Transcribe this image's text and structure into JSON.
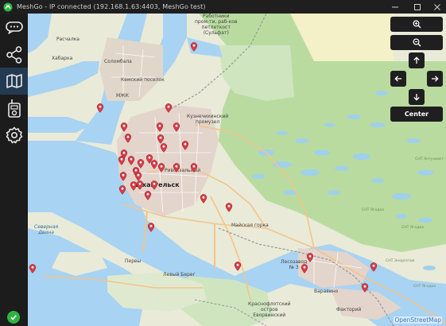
{
  "window": {
    "title": "MeshGo - IP connected (192.168.1.63:4403, MeshGo test)",
    "icon": "meshgo-logo"
  },
  "sidebar": {
    "items": [
      {
        "name": "chats",
        "icon": "chat-bubble-icon",
        "active": false
      },
      {
        "name": "nodes",
        "icon": "network-icon",
        "active": false
      },
      {
        "name": "map",
        "icon": "map-icon",
        "active": true
      },
      {
        "name": "device",
        "icon": "radio-device-icon",
        "active": false
      },
      {
        "name": "settings",
        "icon": "gear-icon",
        "active": false
      }
    ],
    "status_icon": "check-circle-icon",
    "status_color": "#2fb344",
    "active_color": "#243a52"
  },
  "map_controls": {
    "zoom_in": "zoom-in-icon",
    "zoom_out": "zoom-out-icon",
    "up": "arrow-up-icon",
    "left": "arrow-left-icon",
    "right": "arrow-right-icon",
    "down": "arrow-down-icon",
    "center_label": "Center"
  },
  "map": {
    "attribution": "OpenStreetMap",
    "labels": [
      {
        "text": "Работники\nпром-ти, раб-ков\nпетлеткост\n(Сульфат)"
      },
      {
        "text": "Расчалка"
      },
      {
        "text": "Хабарка"
      },
      {
        "text": "Соломбала"
      },
      {
        "text": "Кемский поселок"
      },
      {
        "text": "МЖК"
      },
      {
        "text": "Кузнечихинский\nпромузел"
      },
      {
        "text": "Архангельск"
      },
      {
        "text": "Ривокзальный"
      },
      {
        "text": "Майская горка"
      },
      {
        "text": "Северная\nДвина"
      },
      {
        "text": "Первы"
      },
      {
        "text": "Лесозавод\n№ 3"
      },
      {
        "text": "Варавино"
      },
      {
        "text": "Краснофлотский\nостров\nЕворвинский"
      },
      {
        "text": "Факторий"
      },
      {
        "text": "Левый Берег"
      },
      {
        "text": "СНТ Ягодка"
      },
      {
        "text": "СНТ Ягодка"
      },
      {
        "text": "СНТ Энергетик"
      },
      {
        "text": "СНТ Энтузиаст"
      },
      {
        "text": "СНТ Ягодка"
      }
    ],
    "marker_color": "#d93a45",
    "marker_count": 40
  }
}
